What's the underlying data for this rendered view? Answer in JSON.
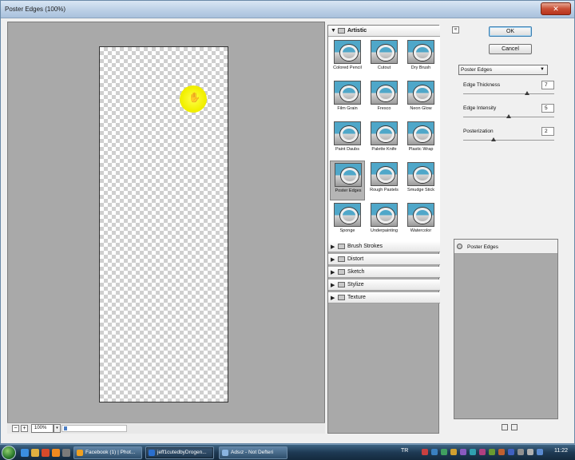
{
  "window": {
    "title": "Poster Edges (100%)",
    "close_label": "✕"
  },
  "preview": {
    "zoom_value": "100%",
    "zoom_out": "−",
    "zoom_in": "+",
    "zoom_drop": "▾"
  },
  "filter_gallery": {
    "open_category": "Artistic",
    "filters": [
      {
        "name": "Colored Pencil",
        "selected": false
      },
      {
        "name": "Cutout",
        "selected": false
      },
      {
        "name": "Dry Brush",
        "selected": false
      },
      {
        "name": "Film Grain",
        "selected": false
      },
      {
        "name": "Fresco",
        "selected": false
      },
      {
        "name": "Neon Glow",
        "selected": false
      },
      {
        "name": "Paint Daubs",
        "selected": false
      },
      {
        "name": "Palette Knife",
        "selected": false
      },
      {
        "name": "Plastic Wrap",
        "selected": false
      },
      {
        "name": "Poster Edges",
        "selected": true
      },
      {
        "name": "Rough Pastels",
        "selected": false
      },
      {
        "name": "Smudge Stick",
        "selected": false
      },
      {
        "name": "Sponge",
        "selected": false
      },
      {
        "name": "Underpainting",
        "selected": false
      },
      {
        "name": "Watercolor",
        "selected": false
      }
    ],
    "categories": [
      "Brush Strokes",
      "Distort",
      "Sketch",
      "Stylize",
      "Texture"
    ]
  },
  "settings": {
    "ok_label": "OK",
    "cancel_label": "Cancel",
    "collapse_label": "«",
    "filter_select": "Poster Edges",
    "params": [
      {
        "label": "Edge Thickness",
        "value": "7",
        "fraction": 0.7
      },
      {
        "label": "Edge Intensity",
        "value": "5",
        "fraction": 0.5
      },
      {
        "label": "Posterization",
        "value": "2",
        "fraction": 0.333
      }
    ]
  },
  "layers": {
    "items": [
      "Poster Edges"
    ]
  },
  "taskbar": {
    "tasks": [
      {
        "label": "Facebook (1) | Phot...",
        "color": "#f0a020"
      },
      {
        "label": "jeff1cutedbyDrogen...",
        "color": "#2a6fcf"
      },
      {
        "label": "Adsız - Not Defteri",
        "color": "#8ab4e0"
      }
    ],
    "language": "TR",
    "clock": "11:22"
  },
  "colors": {
    "highlight": "#f2f000",
    "title_bar": "#bcd0e6",
    "taskbar": "#1e3a54"
  }
}
